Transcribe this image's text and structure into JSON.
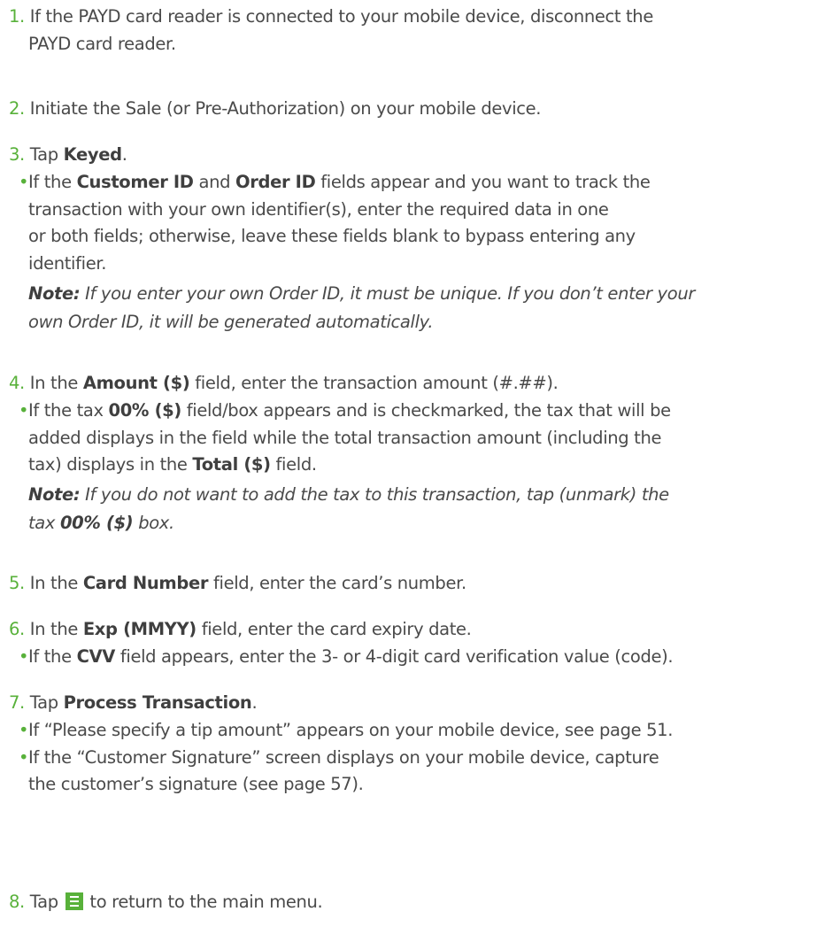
{
  "steps": [
    {
      "num": "1.",
      "lines": [
        "If the PAYD card reader is connected to your mobile device, disconnect the",
        "PAYD card reader."
      ]
    },
    {
      "num": "2.",
      "text": "Initiate the Sale (or Pre-Authorization) on your mobile device."
    },
    {
      "num": "3.",
      "pre": "Tap ",
      "bold": "Keyed",
      "post": ".",
      "bullet": {
        "l1_pre": "If the ",
        "l1_b1": "Customer ID",
        "l1_mid": " and ",
        "l1_b2": "Order ID",
        "l1_post": " fields appear and you want to track the",
        "l2": "transaction with your own identifier(s), enter the required data in one",
        "l3": "or both fields; otherwise, leave these fields blank to bypass entering any",
        "l4": "identifier."
      },
      "note": {
        "label": "Note:",
        "l1": " If you enter your own Order ID, it must be unique. If you don’t enter your",
        "l2": "own Order ID, it will be generated automatically."
      }
    },
    {
      "num": "4.",
      "pre": "In the ",
      "bold": "Amount ($)",
      "post": " field, enter the transaction amount (#.##).",
      "bullet": {
        "l1_pre": "If the tax ",
        "l1_b1": "00% ($)",
        "l1_post": " field/box appears and is checkmarked, the tax that will be",
        "l2": "added displays in the field while the total transaction amount (including the",
        "l3_pre": "tax) displays in the ",
        "l3_b": "Total ($)",
        "l3_post": " field."
      },
      "note": {
        "label": "Note:",
        "l1": " If you do not want to add the tax to this transaction, tap (unmark) the",
        "l2_pre": "tax ",
        "l2_b": "00% ($)",
        "l2_post": " box."
      }
    },
    {
      "num": "5.",
      "pre": "In the ",
      "bold": "Card Number",
      "post": " field, enter the card’s number."
    },
    {
      "num": "6.",
      "pre": "In the ",
      "bold": "Exp (MMYY)",
      "post": " field, enter the card expiry date.",
      "bullet": {
        "l1_pre": "If the ",
        "l1_b1": "CVV",
        "l1_post": " field appears, enter the 3- or 4-digit card verification value (code)."
      }
    },
    {
      "num": "7.",
      "pre": "Tap ",
      "bold": "Process Transaction",
      "post": ".",
      "bullets": [
        "If “Please specify a tip amount” appears on your mobile device, see page 51.",
        "If the “Customer Signature” screen displays on your mobile device, capture"
      ],
      "bullet_cont": "the customer’s signature (see page 57)."
    },
    {
      "num": "8.",
      "pre": "Tap ",
      "icon": "menu-icon",
      "post": " to return to the main menu."
    }
  ],
  "colors": {
    "accent": "#58b13a",
    "text": "#4a4a4a"
  }
}
